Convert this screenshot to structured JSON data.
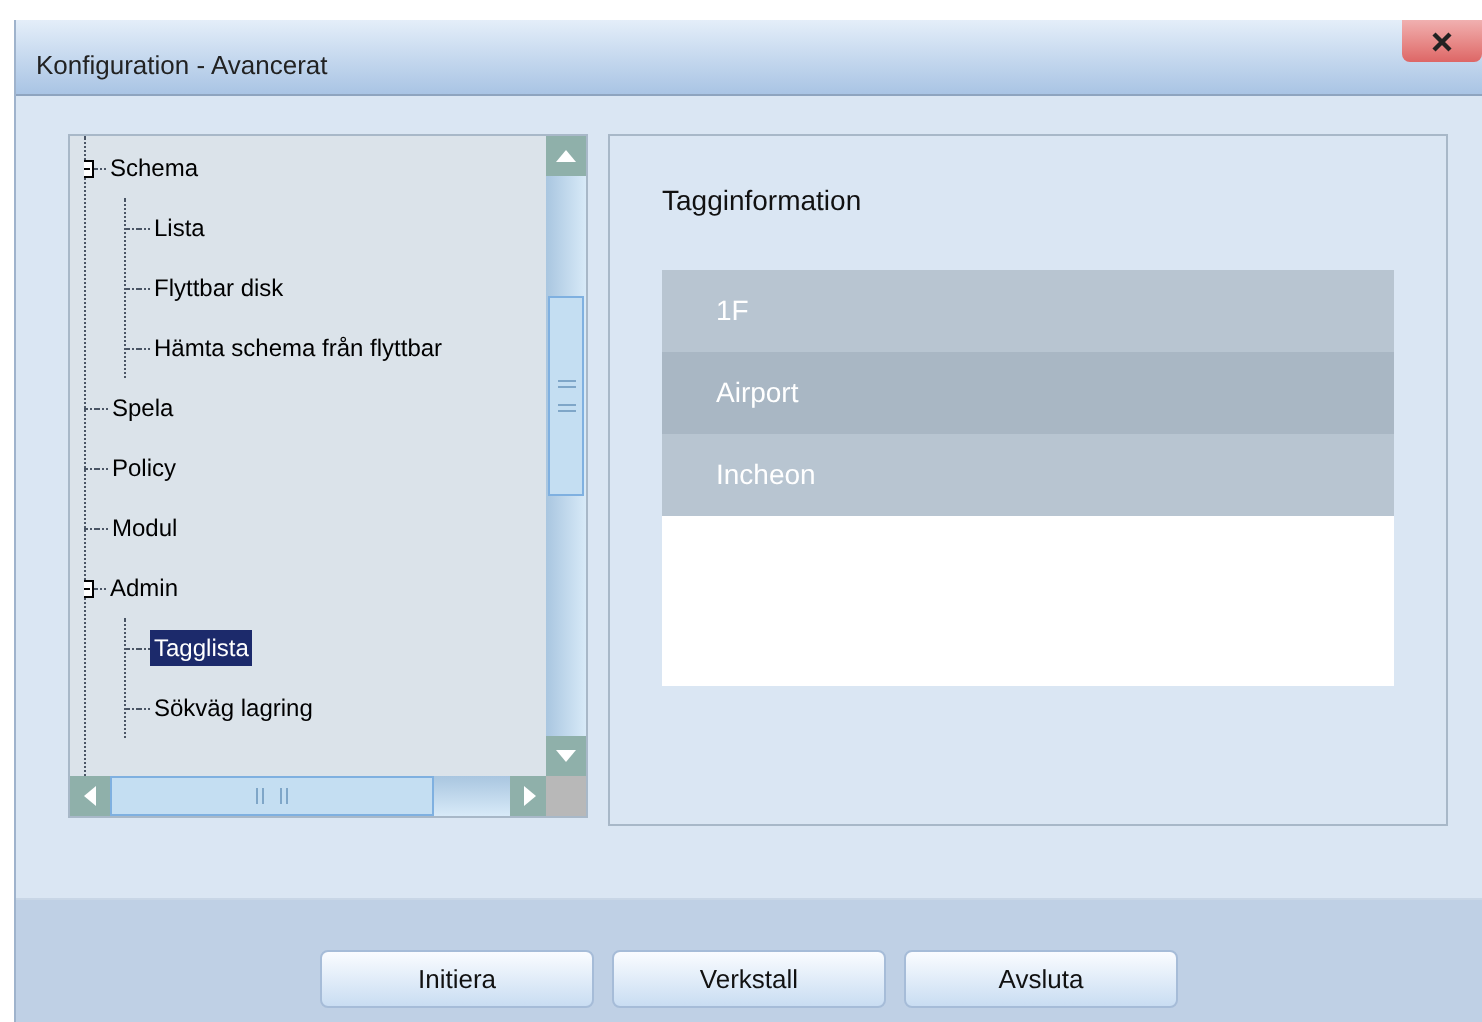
{
  "window": {
    "title": "Konfiguration - Avancerat"
  },
  "tree": [
    {
      "label": "Schema",
      "expanded": true,
      "selected": false,
      "children": [
        {
          "label": "Lista",
          "selected": false
        },
        {
          "label": "Flyttbar disk",
          "selected": false
        },
        {
          "label": "Hämta schema från flyttbar",
          "selected": false
        }
      ]
    },
    {
      "label": "Spela",
      "selected": false
    },
    {
      "label": "Policy",
      "selected": false
    },
    {
      "label": "Modul",
      "selected": false
    },
    {
      "label": "Admin",
      "expanded": true,
      "selected": false,
      "children": [
        {
          "label": "Tagglista",
          "selected": true
        },
        {
          "label": "Sökväg lagring",
          "selected": false
        }
      ]
    }
  ],
  "tag_panel": {
    "title": "Tagginformation",
    "tags": [
      {
        "label": "1F",
        "selected": false
      },
      {
        "label": "Airport",
        "selected": true
      },
      {
        "label": "Incheon",
        "selected": false
      }
    ]
  },
  "buttons": [
    "Initiera",
    "Verkstall",
    "Avsluta"
  ]
}
